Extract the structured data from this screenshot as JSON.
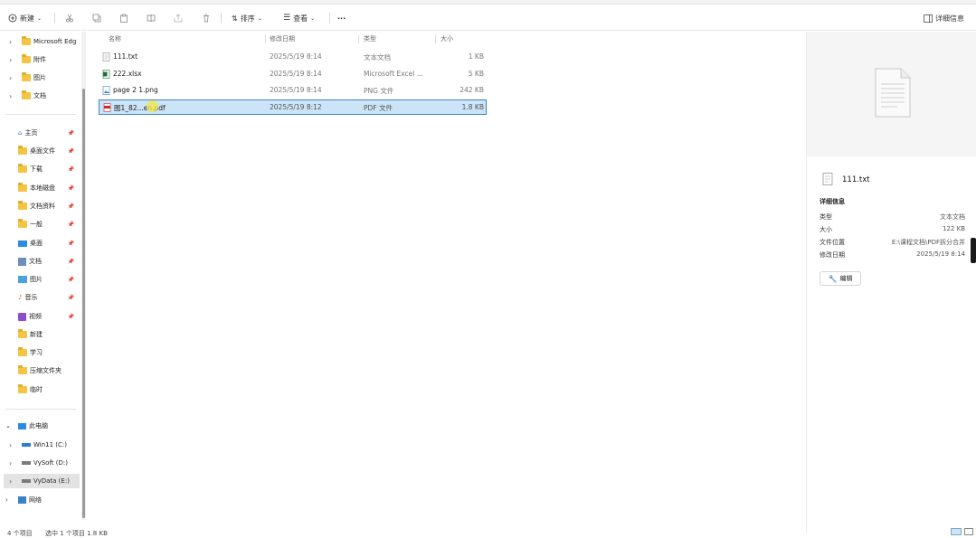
{
  "toolbar": {
    "new_label": "新建",
    "sort_label": "排序",
    "view_label": "查看",
    "more_label": "···",
    "details_label": "详细信息"
  },
  "nav": {
    "tree_top": [
      {
        "label": "Microsoft Edg"
      },
      {
        "label": "附件"
      },
      {
        "label": "图片"
      },
      {
        "label": "文档"
      }
    ],
    "quick_access": [
      {
        "label": "主页"
      },
      {
        "label": "桌面文件"
      },
      {
        "label": "下载"
      },
      {
        "label": "本地磁盘"
      },
      {
        "label": "文档资料"
      },
      {
        "label": "一般"
      },
      {
        "label": "桌面"
      },
      {
        "label": "文档"
      },
      {
        "label": "图片"
      },
      {
        "label": "音乐"
      },
      {
        "label": "视频"
      },
      {
        "label": "新建"
      },
      {
        "label": "学习"
      },
      {
        "label": "压缩文件夹"
      },
      {
        "label": "临时"
      }
    ],
    "this_pc": "此电脑",
    "drives": [
      {
        "label": "Win11 (C:)"
      },
      {
        "label": "VySoft (D:)"
      },
      {
        "label": "VyData (E:)"
      }
    ],
    "network": "网络"
  },
  "columns": {
    "name": "名称",
    "date": "修改日期",
    "type": "类型",
    "size": "大小"
  },
  "files": [
    {
      "name": "111.txt",
      "date": "2025/5/19 8:14",
      "type": "文本文档",
      "size": "1 KB"
    },
    {
      "name": "222.xlsx",
      "date": "2025/5/19 8:14",
      "type": "Microsoft Excel ...",
      "size": "5 KB"
    },
    {
      "name": "page 2 1.png",
      "date": "2025/5/19 8:14",
      "type": "PNG 文件",
      "size": "242 KB"
    },
    {
      "name": "图1_82...en.pdf",
      "date": "2025/5/19 8:12",
      "type": "PDF 文件",
      "size": "1.8 KB"
    }
  ],
  "details": {
    "file_name": "111.txt",
    "section_title": "详细信息",
    "props": [
      {
        "label": "类型",
        "value": "文本文档"
      },
      {
        "label": "大小",
        "value": "122 KB"
      },
      {
        "label": "文件位置",
        "value": "E:\\课程文档\\PDF拆分合并"
      },
      {
        "label": "修改日期",
        "value": "2025/5/19 8:14"
      }
    ],
    "edit_button": "编辑"
  },
  "status": {
    "count": "4 个项目",
    "selected": "选中 1 个项目 1.8 KB"
  }
}
